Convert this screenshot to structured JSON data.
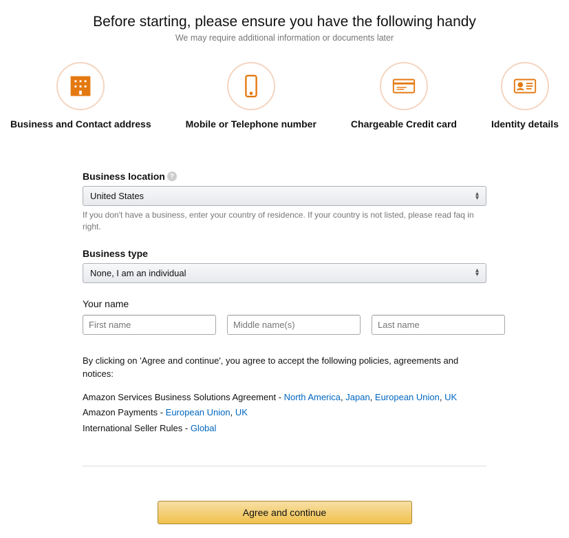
{
  "header": {
    "title": "Before starting, please ensure you have the following handy",
    "subtitle": "We may require additional information or documents later"
  },
  "requirements": [
    {
      "label": "Business and Contact address",
      "icon": "building-icon"
    },
    {
      "label": "Mobile or Telephone number",
      "icon": "phone-icon"
    },
    {
      "label": "Chargeable Credit card",
      "icon": "credit-card-icon"
    },
    {
      "label": "Identity details",
      "icon": "id-card-icon"
    }
  ],
  "form": {
    "business_location": {
      "label": "Business location",
      "value": "United States",
      "hint": "If you don't have a business, enter your country of residence. If your country is not listed, please read faq in right."
    },
    "business_type": {
      "label": "Business type",
      "value": "None, I am an individual"
    },
    "your_name": {
      "label": "Your name",
      "first_placeholder": "First name",
      "middle_placeholder": "Middle name(s)",
      "last_placeholder": "Last name"
    }
  },
  "policies": {
    "intro": "By clicking on 'Agree and continue', you agree to accept the following policies, agreements and notices:",
    "rows": [
      {
        "prefix": "Amazon Services Business Solutions Agreement - ",
        "links": [
          "North America",
          "Japan",
          "European Union",
          "UK"
        ]
      },
      {
        "prefix": "Amazon Payments - ",
        "links": [
          "European Union",
          "UK"
        ]
      },
      {
        "prefix": "International Seller Rules - ",
        "links": [
          "Global"
        ]
      }
    ]
  },
  "continue_button": "Agree and continue"
}
